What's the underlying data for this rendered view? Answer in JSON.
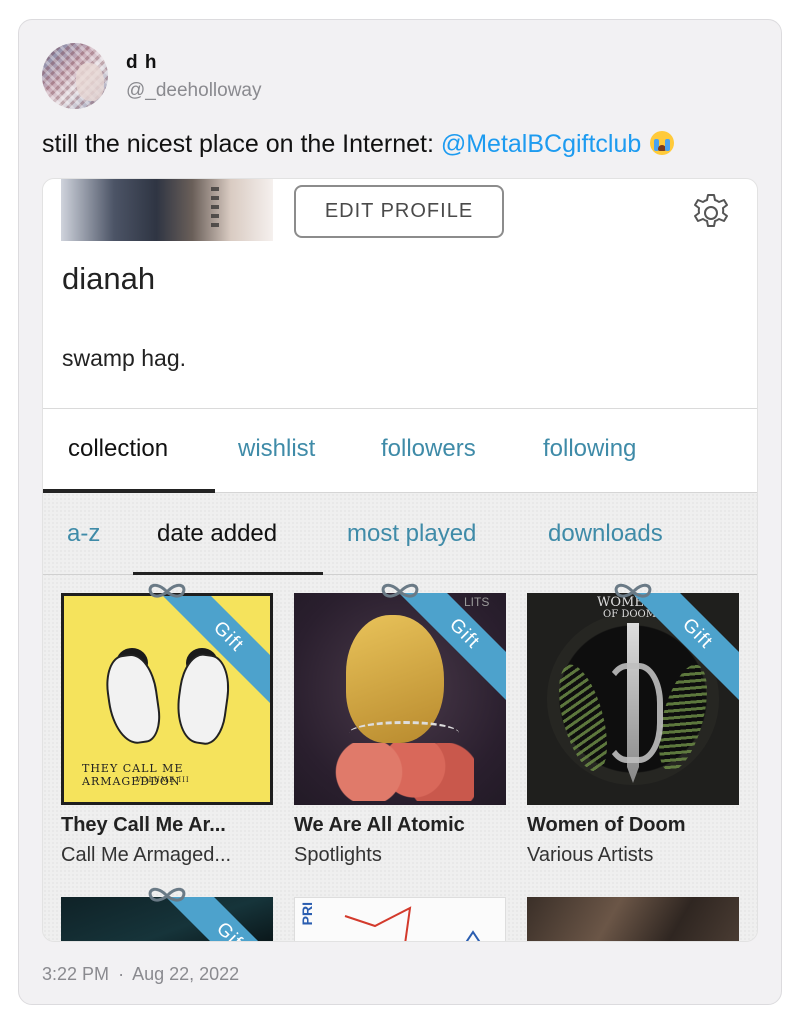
{
  "tweet": {
    "display_name": "d h",
    "handle": "@_deeholloway",
    "text_prefix": "still the nicest place on the Internet: ",
    "mention": "@MetalBCgiftclub",
    "emoji_icon": "loudly-crying-face-icon",
    "time": "3:22 PM",
    "separator": "·",
    "date": "Aug 22, 2022"
  },
  "profile": {
    "edit_profile_label": "EDIT PROFILE",
    "settings_icon": "gear-icon",
    "name": "dianah",
    "bio": "swamp hag."
  },
  "main_tabs": [
    {
      "label": "collection",
      "active": true
    },
    {
      "label": "wishlist",
      "active": false
    },
    {
      "label": "followers",
      "active": false
    },
    {
      "label": "following",
      "active": false
    }
  ],
  "sub_tabs": [
    {
      "label": "a-z",
      "active": false
    },
    {
      "label": "date added",
      "active": true
    },
    {
      "label": "most played",
      "active": false
    },
    {
      "label": "downloads",
      "active": false
    }
  ],
  "albums": [
    {
      "title": "They Call Me Ar...",
      "artist": "Call Me Armaged...",
      "gift_label": "Gift",
      "cover_text": "THEY CALL ME ARMAGEDDON",
      "cover_sub": "VOLUME III"
    },
    {
      "title": "We Are All Atomic",
      "artist": "Spotlights",
      "gift_label": "Gift",
      "cover_text": "LITS"
    },
    {
      "title": "Women of Doom",
      "artist": "Various Artists",
      "gift_label": "Gift",
      "cover_text_1": "WOMEN",
      "cover_text_2": "OF DOOM"
    }
  ],
  "albums_row2": [
    {
      "gift_label": "Gift"
    },
    {
      "cover_text": "PRI"
    },
    {}
  ],
  "colors": {
    "link_blue": "#1d9bf0",
    "tab_blue": "#3f8ba8",
    "gift_blue": "#4da2cc"
  }
}
